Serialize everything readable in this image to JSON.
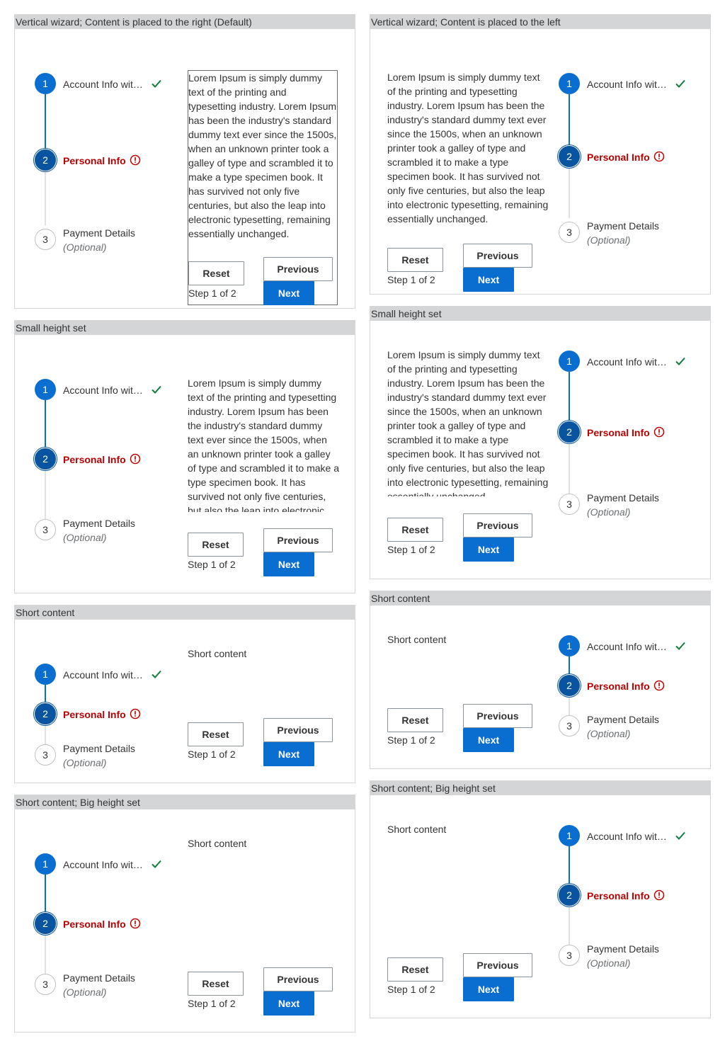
{
  "demos": [
    {
      "title": "Vertical wizard; Content is placed to the right (Default)"
    },
    {
      "title": "Vertical wizard; Content is placed to the left"
    },
    {
      "title": "Small height set"
    },
    {
      "title": "Small height set"
    },
    {
      "title": "Short content"
    },
    {
      "title": "Short content"
    },
    {
      "title": "Short content; Big height set"
    },
    {
      "title": "Short content; Big height set"
    }
  ],
  "steps": [
    {
      "number": "1",
      "label": "Account Info wit…",
      "status": "completed"
    },
    {
      "number": "2",
      "label": "Personal Info",
      "status": "error"
    },
    {
      "number": "3",
      "label": "Payment Details",
      "optional": "(Optional)",
      "status": "upcoming"
    }
  ],
  "long_text": "Lorem Ipsum is simply dummy text of the printing and typesetting industry. Lorem Ipsum has been the industry's standard dummy text ever since the 1500s, when an unknown printer took a galley of type and scrambled it to make a type specimen book. It has survived not only five centuries, but also the leap into electronic typesetting, remaining essentially unchanged.",
  "short_text": "Short content",
  "buttons": {
    "reset": "Reset",
    "previous": "Previous",
    "next": "Next"
  },
  "step_info": "Step 1 of 2",
  "colors": {
    "accent": "#0a6ed1",
    "current": "#0854a0",
    "error": "#bb0000",
    "success": "#107e3e",
    "header": "#d3d5d7"
  }
}
